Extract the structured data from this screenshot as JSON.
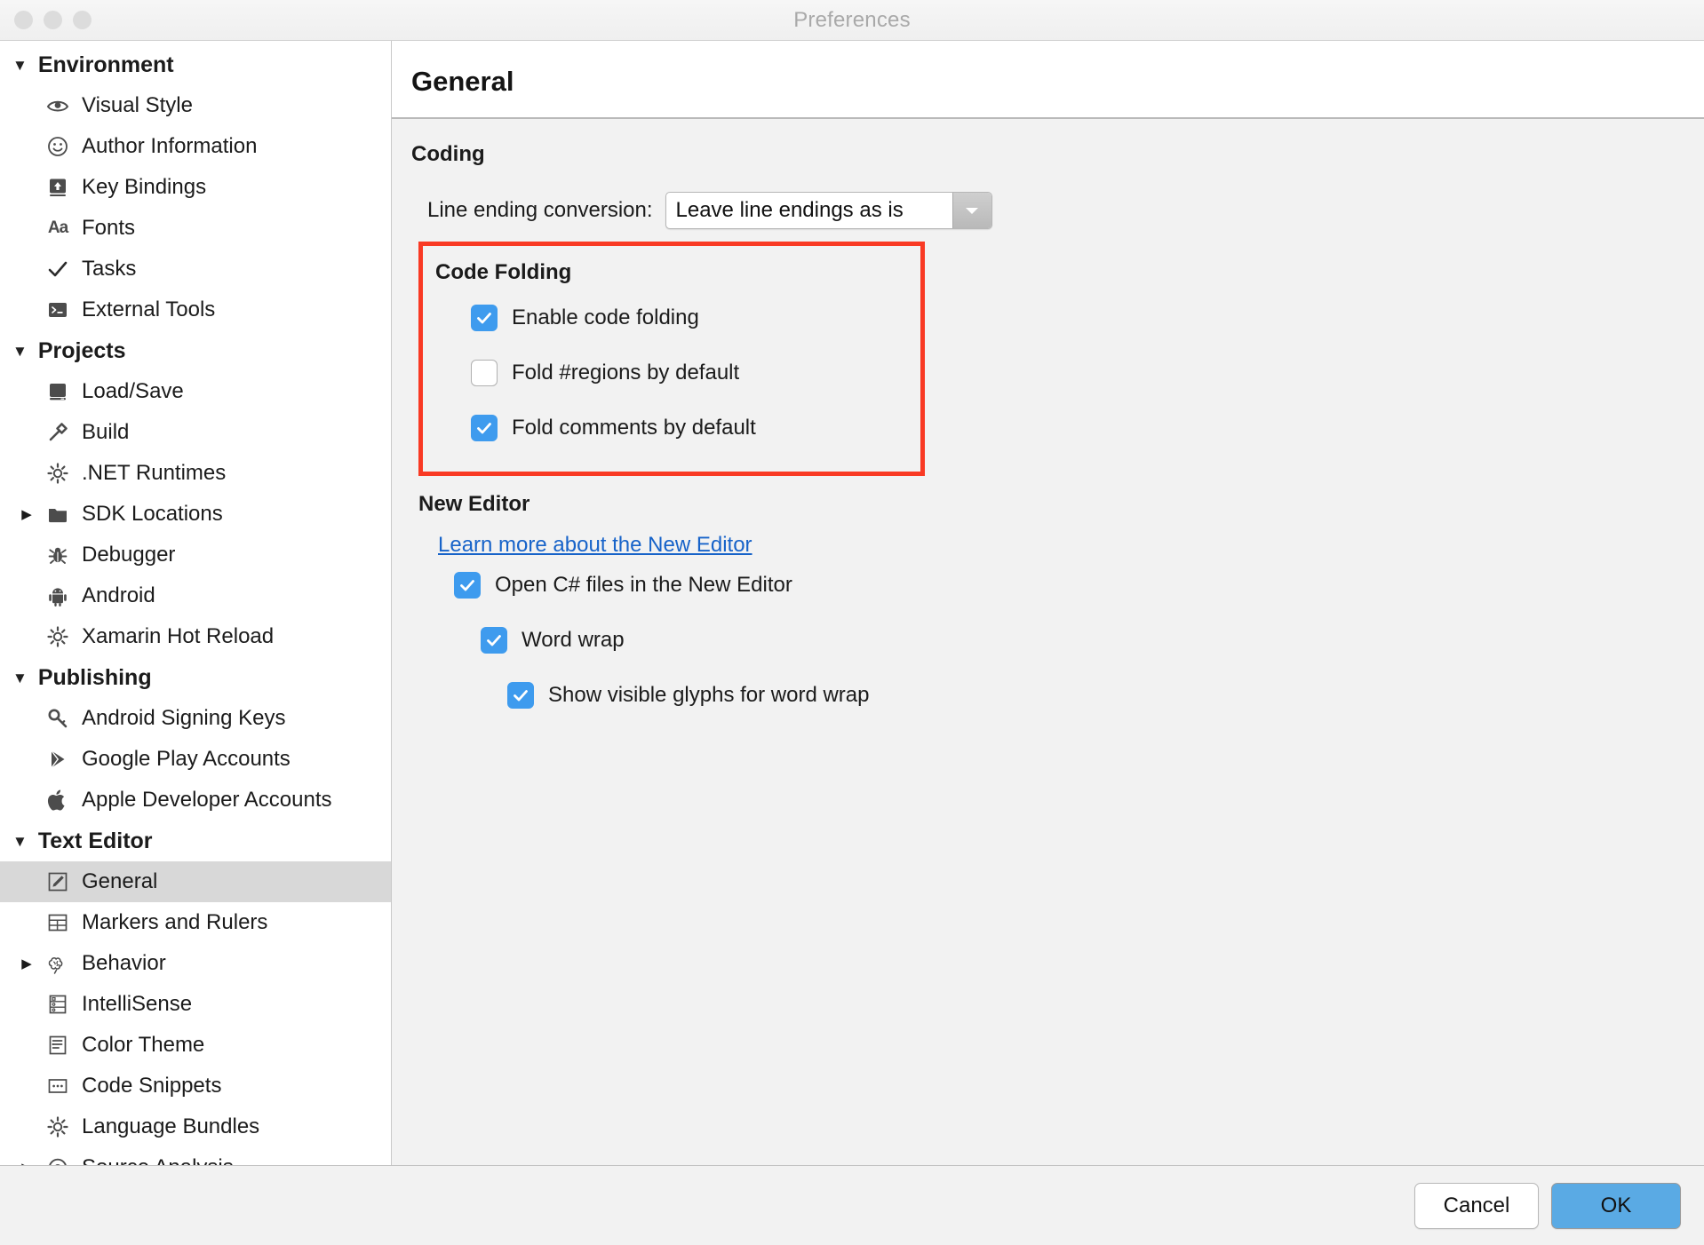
{
  "window": {
    "title": "Preferences"
  },
  "sidebar": {
    "groups": [
      {
        "label": "Environment",
        "items": [
          {
            "label": "Visual Style",
            "icon": "eye-icon"
          },
          {
            "label": "Author Information",
            "icon": "smiley-icon"
          },
          {
            "label": "Key Bindings",
            "icon": "keyboard-upload-icon"
          },
          {
            "label": "Fonts",
            "icon": "aa-text-icon"
          },
          {
            "label": "Tasks",
            "icon": "check-icon"
          },
          {
            "label": "External Tools",
            "icon": "terminal-icon"
          }
        ]
      },
      {
        "label": "Projects",
        "items": [
          {
            "label": "Load/Save",
            "icon": "book-icon"
          },
          {
            "label": "Build",
            "icon": "hammer-icon"
          },
          {
            "label": ".NET Runtimes",
            "icon": "gear-icon"
          },
          {
            "label": "SDK Locations",
            "icon": "folder-icon",
            "expandable": true
          },
          {
            "label": "Debugger",
            "icon": "bug-icon"
          },
          {
            "label": "Android",
            "icon": "android-icon"
          },
          {
            "label": "Xamarin Hot Reload",
            "icon": "gear-icon"
          }
        ]
      },
      {
        "label": "Publishing",
        "items": [
          {
            "label": "Android Signing Keys",
            "icon": "key-icon"
          },
          {
            "label": "Google Play Accounts",
            "icon": "play-store-icon"
          },
          {
            "label": "Apple Developer Accounts",
            "icon": "apple-icon"
          }
        ]
      },
      {
        "label": "Text Editor",
        "items": [
          {
            "label": "General",
            "icon": "pencil-square-icon",
            "selected": true
          },
          {
            "label": "Markers and Rulers",
            "icon": "table-icon"
          },
          {
            "label": "Behavior",
            "icon": "brain-icon",
            "expandable": true
          },
          {
            "label": "IntelliSense",
            "icon": "list-icon"
          },
          {
            "label": "Color Theme",
            "icon": "document-lines-icon"
          },
          {
            "label": "Code Snippets",
            "icon": "ellipsis-box-icon"
          },
          {
            "label": "Language Bundles",
            "icon": "gear-icon"
          },
          {
            "label": "Source Analysis",
            "icon": "target-icon",
            "expandable": true
          }
        ]
      }
    ]
  },
  "pane": {
    "title": "General",
    "coding": {
      "section_title": "Coding",
      "line_ending_label": "Line ending conversion:",
      "line_ending_value": "Leave line endings as is"
    },
    "code_folding": {
      "section_title": "Code Folding",
      "options": [
        {
          "label": "Enable code folding",
          "checked": true
        },
        {
          "label": "Fold #regions by default",
          "checked": false
        },
        {
          "label": "Fold comments by default",
          "checked": true
        }
      ],
      "highlight_color": "#f93a24"
    },
    "new_editor": {
      "section_title": "New Editor",
      "link_label": "Learn more about the New Editor",
      "options": [
        {
          "label": "Open C# files in the New Editor",
          "checked": true,
          "indent": 1
        },
        {
          "label": "Word wrap",
          "checked": true,
          "indent": 2
        },
        {
          "label": "Show visible glyphs for word wrap",
          "checked": true,
          "indent": 3
        }
      ]
    }
  },
  "footer": {
    "cancel_label": "Cancel",
    "ok_label": "OK",
    "ok_color": "#5aaae4"
  }
}
